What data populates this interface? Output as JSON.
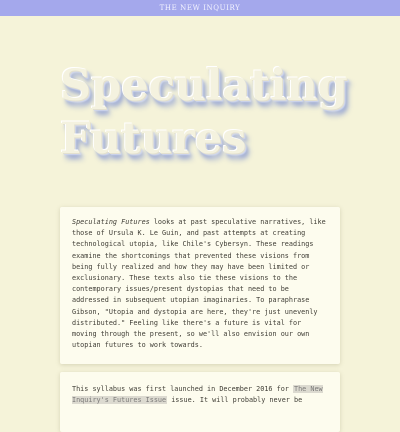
{
  "header": {
    "site_name": "THE NEW INQUIRY"
  },
  "hero": {
    "title_line1": "Speculating",
    "title_line2": "Futures"
  },
  "intro_card": {
    "emphasis": "Speculating Futures",
    "body": " looks at past speculative narratives, like those of Ursula K. Le Guin, and past attempts at creating technological utopia, like Chile's Cybersyn. These readings examine the shortcomings that prevented these visions from being fully realized and how they may have been limited or exclusionary. These texts also tie these visions to the contemporary issues/present dystopias that need to be addressed in subsequent utopian imaginaries. To paraphrase Gibson, \"Utopia and dystopia are here, they're just unevenly distributed.\" Feeling like there's a future is vital for moving through the present, so we'll also envision our own utopian futures to work towards."
  },
  "launch_card": {
    "text_before": "This syllabus was first launched in December 2016 for ",
    "link_text": "The New Inquiry's Futures Issue",
    "text_after": " issue. It will probably never be"
  }
}
